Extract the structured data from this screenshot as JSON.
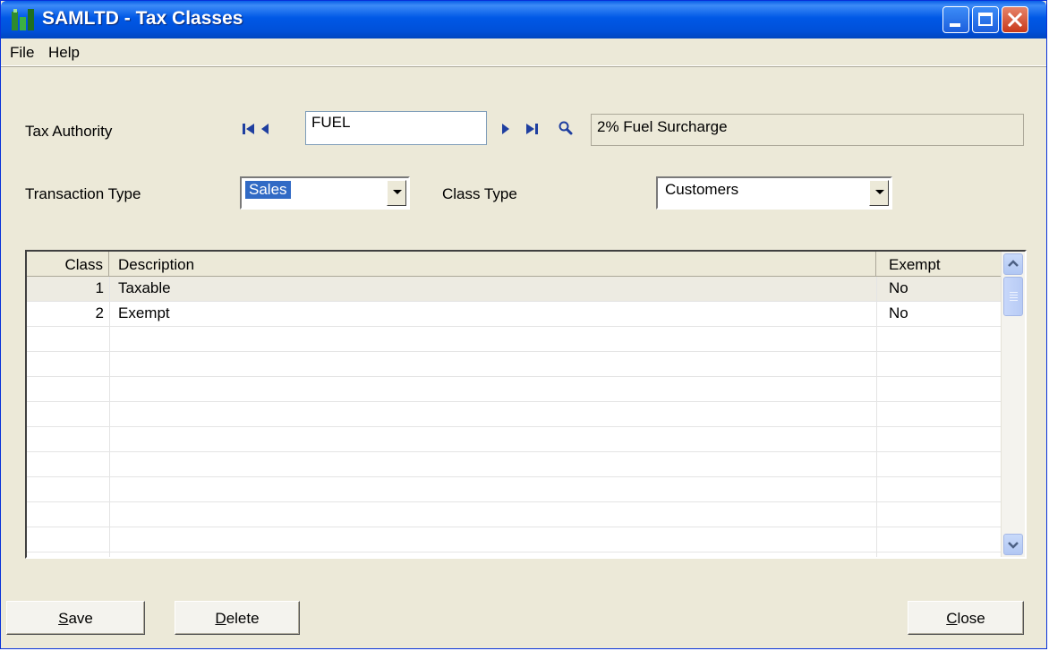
{
  "window": {
    "title": "SAMLTD - Tax Classes"
  },
  "menu": {
    "file": "File",
    "help": "Help"
  },
  "tax_authority": {
    "label": "Tax Authority",
    "code": "FUEL",
    "description": "2% Fuel Surcharge"
  },
  "transaction_type": {
    "label": "Transaction Type",
    "value": "Sales"
  },
  "class_type": {
    "label": "Class Type",
    "value": "Customers"
  },
  "grid": {
    "columns": {
      "class": "Class",
      "description": "Description",
      "exempt": "Exempt"
    },
    "rows": [
      {
        "class": "1",
        "description": "Taxable",
        "exempt": "No"
      },
      {
        "class": "2",
        "description": "Exempt",
        "exempt": "No"
      }
    ]
  },
  "buttons": {
    "save": {
      "mnemonic": "S",
      "rest": "ave"
    },
    "delete": {
      "mnemonic": "D",
      "rest": "elete"
    },
    "close": {
      "mnemonic": "C",
      "rest": "lose"
    }
  },
  "icons": {
    "app": "sage-app-icon",
    "first": "first-record-icon",
    "previous": "previous-record-icon",
    "next": "next-record-icon",
    "last": "last-record-icon",
    "lookup": "magnifier-icon"
  },
  "colors": {
    "titlebar": "#0054E3",
    "window_bg": "#ECE9D8",
    "selection": "#316AC5",
    "close_button": "#D8441F"
  }
}
